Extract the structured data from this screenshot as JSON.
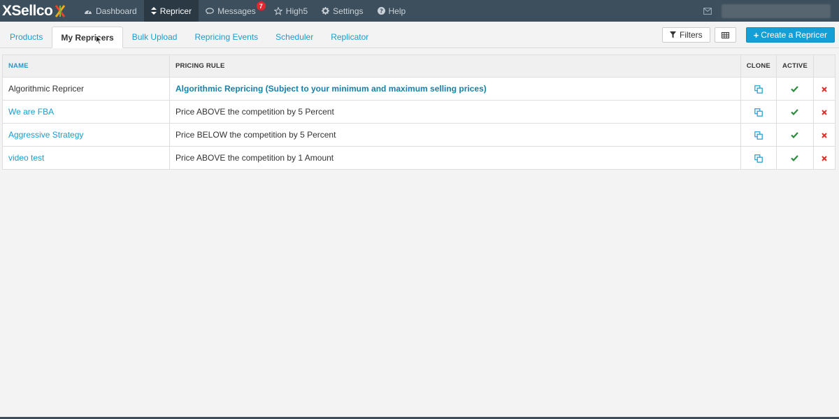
{
  "app": {
    "logo_text": "XSellco",
    "nav": [
      {
        "label": "Dashboard",
        "icon": "dashboard-icon"
      },
      {
        "label": "Repricer",
        "icon": "sort-icon"
      },
      {
        "label": "Messages",
        "icon": "comments-icon",
        "badge": "7"
      },
      {
        "label": "High5",
        "icon": "star-icon"
      },
      {
        "label": "Settings",
        "icon": "gear-icon"
      },
      {
        "label": "Help",
        "icon": "question-icon"
      }
    ]
  },
  "tabs": [
    {
      "label": "Products"
    },
    {
      "label": "My Repricers"
    },
    {
      "label": "Bulk Upload"
    },
    {
      "label": "Repricing Events"
    },
    {
      "label": "Scheduler"
    },
    {
      "label": "Replicator"
    }
  ],
  "actions": {
    "filters_label": "Filters",
    "create_label": "Create a Repricer"
  },
  "table": {
    "headers": {
      "name": "NAME",
      "rule": "PRICING RULE",
      "clone": "CLONE",
      "active": "ACTIVE"
    },
    "rows": [
      {
        "name": "Algorithmic Repricer",
        "rule": "Algorithmic Repricing (Subject to your minimum and maximum selling prices)"
      },
      {
        "name": "We are FBA",
        "rule": "Price ABOVE the competition by 5 Percent"
      },
      {
        "name": "Aggressive Strategy",
        "rule": "Price BELOW the competition by 5 Percent"
      },
      {
        "name": "video test",
        "rule": "Price ABOVE the competition by 1 Amount"
      }
    ]
  },
  "colors": {
    "navbar": "#3d4f5d",
    "accent": "#14a0d6",
    "link": "#1a9ccc",
    "success": "#2e8b3e",
    "danger": "#d9302c",
    "badge": "#e0282e"
  }
}
